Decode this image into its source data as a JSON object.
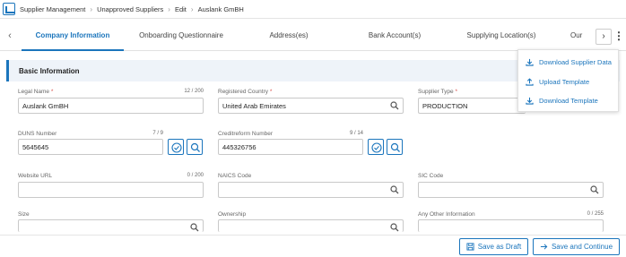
{
  "breadcrumb": [
    "Supplier Management",
    "Unapproved Suppliers",
    "Edit",
    "Auslank GmBH"
  ],
  "tabs": [
    "Company Information",
    "Onboarding Questionnaire",
    "Address(es)",
    "Bank Account(s)",
    "Supplying Location(s)",
    "Our"
  ],
  "section_title": "Basic Information",
  "menu": {
    "download_supplier_data": "Download Supplier Data",
    "upload_template": "Upload Template",
    "download_template": "Download Template"
  },
  "fields": {
    "legal_name": {
      "label": "Legal Name",
      "counter": "12 / 200",
      "value": "Auslank GmBH"
    },
    "registered_country": {
      "label": "Registered Country",
      "value": "United Arab Emirates"
    },
    "supplier_type": {
      "label": "Supplier Type",
      "value": "PRODUCTION"
    },
    "duns_number": {
      "label": "DUNS Number",
      "counter": "7 / 9",
      "value": "5645645"
    },
    "creditreform_number": {
      "label": "Creditreform Number",
      "counter": "9 / 14",
      "value": "445326756"
    },
    "website_url": {
      "label": "Website URL",
      "counter": "0 / 200",
      "value": ""
    },
    "naics_code": {
      "label": "NAICS Code",
      "value": ""
    },
    "sic_code": {
      "label": "SIC Code",
      "value": ""
    },
    "size": {
      "label": "Size",
      "value": ""
    },
    "ownership": {
      "label": "Ownership",
      "value": ""
    },
    "any_other_information": {
      "label": "Any Other Information",
      "counter": "0 / 255",
      "value": ""
    }
  },
  "footer": {
    "save_draft": "Save as Draft",
    "save_continue": "Save and Continue"
  },
  "colors": {
    "accent": "#1b75bc",
    "required": "#d9534f",
    "section_bg": "#eef3f9"
  }
}
